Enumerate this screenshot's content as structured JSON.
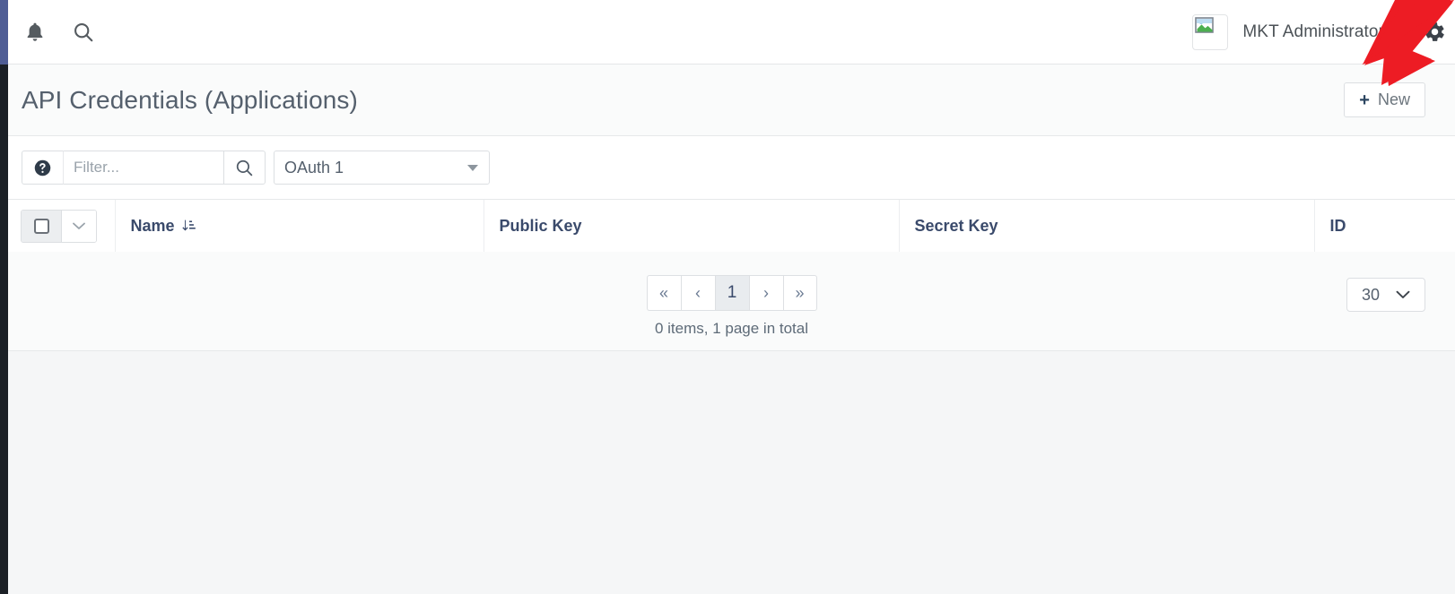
{
  "topbar": {
    "notifications_icon": "bell-icon",
    "search_icon": "search-icon",
    "avatar_icon": "broken-image-icon",
    "user_name": "MKT Administrator",
    "user_caret_icon": "caret-down-icon",
    "settings_icon": "gear-icon"
  },
  "header": {
    "title": "API Credentials (Applications)",
    "new_button": {
      "plus": "+",
      "label": "New"
    }
  },
  "toolbar": {
    "help_icon": "question-circle-icon",
    "filter_placeholder": "Filter...",
    "filter_value": "",
    "search_icon": "search-icon",
    "type_select": {
      "value": "OAuth 1",
      "caret_icon": "caret-down-icon"
    }
  },
  "table": {
    "select_all": {
      "checkbox_icon": "checkbox-unchecked-icon",
      "dropdown_icon": "chevron-down-icon"
    },
    "columns": [
      {
        "key": "name",
        "label": "Name",
        "sort_icon": "sort-amount-asc-icon"
      },
      {
        "key": "public_key",
        "label": "Public Key",
        "sort_icon": ""
      },
      {
        "key": "secret_key",
        "label": "Secret Key",
        "sort_icon": ""
      },
      {
        "key": "id",
        "label": "ID",
        "sort_icon": ""
      }
    ],
    "rows": []
  },
  "pagination": {
    "first_label": "«",
    "prev_label": "‹",
    "pages": [
      "1"
    ],
    "current_page": "1",
    "next_label": "›",
    "last_label": "»",
    "summary": "0 items, 1 page in total",
    "page_size": "30",
    "page_size_caret_icon": "chevron-down-icon"
  },
  "annotation": {
    "arrow_color": "#ed1c24",
    "points_to": "new-button"
  },
  "colors": {
    "rail_top": "#4f5d95",
    "rail_bottom": "#1b2026",
    "header_text": "#55606d",
    "table_header_text": "#3a4a6b",
    "page_bg": "#f5f6f7"
  }
}
